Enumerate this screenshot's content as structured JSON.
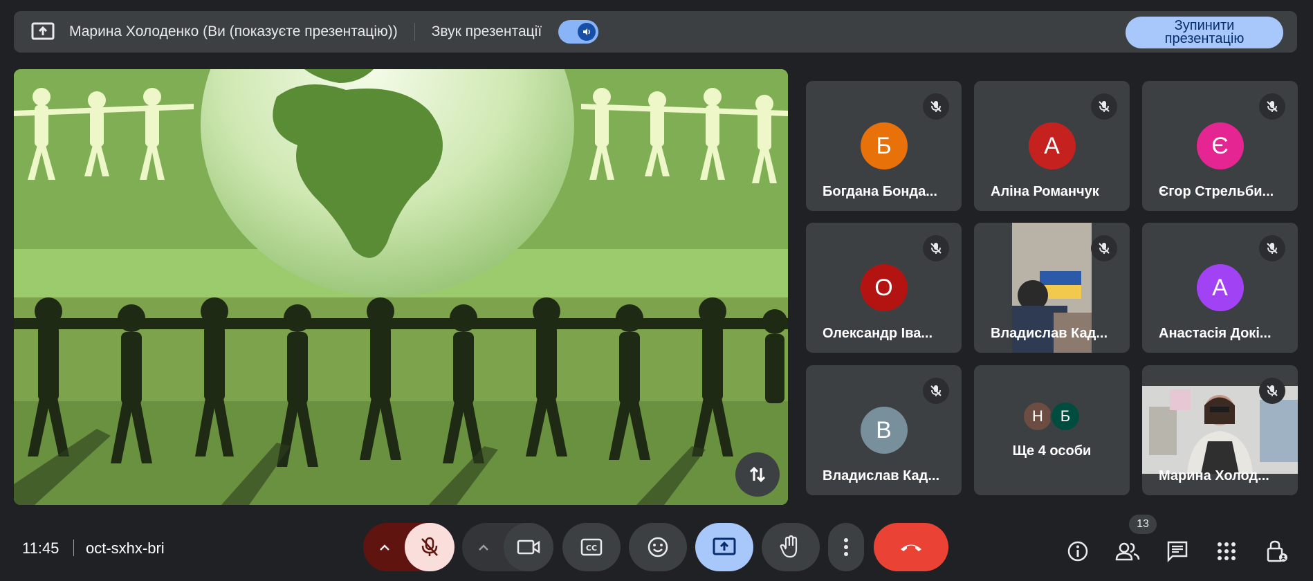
{
  "banner": {
    "presenter": "Марина Холоденко (Ви (показуєте презентацію))",
    "sound_label": "Звук презентації",
    "stop_button": "Зупинити презентацію"
  },
  "participants": [
    {
      "name": "Богдана Бонда...",
      "initial": "Б",
      "color": "#e8710a"
    },
    {
      "name": "Аліна Романчук",
      "initial": "А",
      "color": "#c5221f"
    },
    {
      "name": "Єгор Стрельби...",
      "initial": "Є",
      "color": "#e52592"
    },
    {
      "name": "Олександр Іва...",
      "initial": "О",
      "color": "#b31412"
    },
    {
      "name": "Владислав Кад...",
      "video": true
    },
    {
      "name": "Анастасія Докі...",
      "initial": "А",
      "color": "#a142f4"
    },
    {
      "name": "Владислав Кад...",
      "initial": "В",
      "color": "#78909c"
    },
    {
      "more": true,
      "initials": [
        "Н",
        "Б"
      ],
      "colors": [
        "#6d4c41",
        "#004d40"
      ],
      "label": "Ще 4 особи"
    },
    {
      "name": "Марина Холод...",
      "video": true
    }
  ],
  "footer": {
    "time": "11:45",
    "meeting_code": "oct-sxhx-bri",
    "participant_count": "13"
  },
  "colors": {
    "end_call": "#ea4335",
    "accent": "#a8c7fa",
    "mic_off_bg": "#f9dedc",
    "mic_group_bg": "#601410"
  }
}
